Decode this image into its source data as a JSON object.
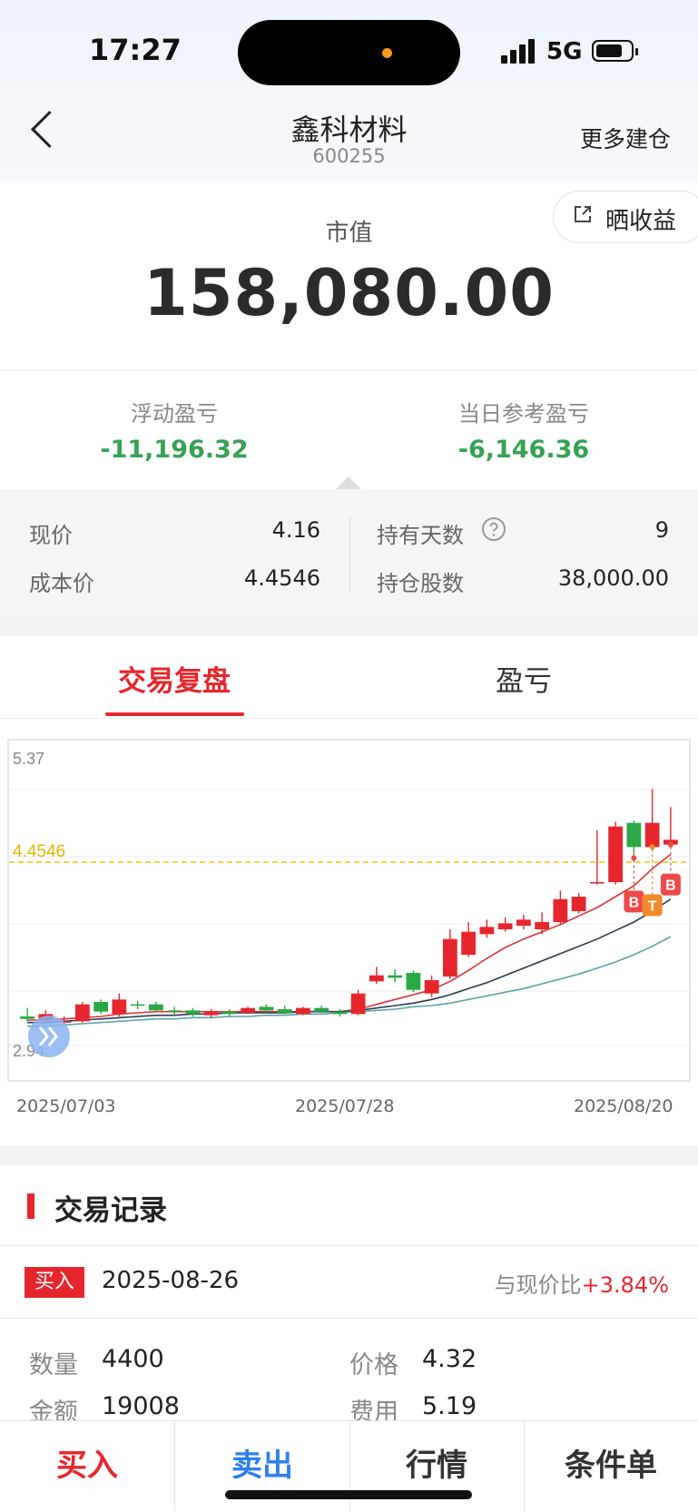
{
  "status_bar": {
    "time": "17:27",
    "network": "5G"
  },
  "header": {
    "title": "鑫科材料",
    "code": "600255",
    "more_label": "更多建仓"
  },
  "share": {
    "label": "晒收益"
  },
  "market_value": {
    "label": "市值",
    "value": "158,080.00"
  },
  "pnl": {
    "floating_label": "浮动盈亏",
    "floating_value": "-11,196.32",
    "daily_label": "当日参考盈亏",
    "daily_value": "-6,146.36"
  },
  "position": {
    "price_label": "现价",
    "price_value": "4.16",
    "cost_label": "成本价",
    "cost_value": "4.4546",
    "days_label": "持有天数",
    "days_value": "9",
    "shares_label": "持仓股数",
    "shares_value": "38,000.00"
  },
  "tabs": [
    {
      "label": "交易复盘"
    },
    {
      "label": "盈亏"
    }
  ],
  "chart": {
    "y_max_label": "5.37",
    "y_min_label": "2.94",
    "cost_line_label": "4.4546",
    "x_labels": [
      "2025/07/03",
      "2025/07/28",
      "2025/08/20"
    ],
    "markers": {
      "buy": "B",
      "t": "T"
    }
  },
  "chart_data": {
    "type": "candlestick",
    "ylim": [
      2.94,
      5.37
    ],
    "cost_line": 4.4546,
    "up_color": "#e5272d",
    "down_color": "#2aa845",
    "candles": [
      {
        "o": 3.18,
        "c": 3.16,
        "h": 3.25,
        "l": 3.14
      },
      {
        "o": 3.15,
        "c": 3.2,
        "h": 3.23,
        "l": 3.13
      },
      {
        "o": 3.13,
        "c": 3.14,
        "h": 3.18,
        "l": 3.11
      },
      {
        "o": 3.14,
        "c": 3.28,
        "h": 3.3,
        "l": 3.13
      },
      {
        "o": 3.3,
        "c": 3.22,
        "h": 3.32,
        "l": 3.2
      },
      {
        "o": 3.2,
        "c": 3.32,
        "h": 3.37,
        "l": 3.18
      },
      {
        "o": 3.28,
        "c": 3.27,
        "h": 3.31,
        "l": 3.24
      },
      {
        "o": 3.28,
        "c": 3.23,
        "h": 3.3,
        "l": 3.22
      },
      {
        "o": 3.23,
        "c": 3.22,
        "h": 3.26,
        "l": 3.19
      },
      {
        "o": 3.23,
        "c": 3.2,
        "h": 3.25,
        "l": 3.18
      },
      {
        "o": 3.19,
        "c": 3.22,
        "h": 3.24,
        "l": 3.17
      },
      {
        "o": 3.22,
        "c": 3.2,
        "h": 3.24,
        "l": 3.18
      },
      {
        "o": 3.21,
        "c": 3.25,
        "h": 3.26,
        "l": 3.2
      },
      {
        "o": 3.26,
        "c": 3.23,
        "h": 3.28,
        "l": 3.21
      },
      {
        "o": 3.24,
        "c": 3.21,
        "h": 3.27,
        "l": 3.2
      },
      {
        "o": 3.2,
        "c": 3.25,
        "h": 3.26,
        "l": 3.19
      },
      {
        "o": 3.25,
        "c": 3.22,
        "h": 3.27,
        "l": 3.21
      },
      {
        "o": 3.22,
        "c": 3.2,
        "h": 3.24,
        "l": 3.18
      },
      {
        "o": 3.2,
        "c": 3.37,
        "h": 3.4,
        "l": 3.19
      },
      {
        "o": 3.47,
        "c": 3.52,
        "h": 3.59,
        "l": 3.45
      },
      {
        "o": 3.52,
        "c": 3.5,
        "h": 3.57,
        "l": 3.46
      },
      {
        "o": 3.54,
        "c": 3.4,
        "h": 3.56,
        "l": 3.38
      },
      {
        "o": 3.37,
        "c": 3.48,
        "h": 3.52,
        "l": 3.34
      },
      {
        "o": 3.51,
        "c": 3.82,
        "h": 3.9,
        "l": 3.49
      },
      {
        "o": 3.69,
        "c": 3.88,
        "h": 3.96,
        "l": 3.67
      },
      {
        "o": 3.86,
        "c": 3.92,
        "h": 3.98,
        "l": 3.83
      },
      {
        "o": 3.9,
        "c": 3.95,
        "h": 4.0,
        "l": 3.88
      },
      {
        "o": 3.93,
        "c": 3.98,
        "h": 4.02,
        "l": 3.9
      },
      {
        "o": 3.9,
        "c": 3.96,
        "h": 4.04,
        "l": 3.86
      },
      {
        "o": 3.96,
        "c": 4.15,
        "h": 4.22,
        "l": 3.94
      },
      {
        "o": 4.05,
        "c": 4.17,
        "h": 4.2,
        "l": 4.03
      },
      {
        "o": 4.29,
        "c": 4.29,
        "h": 4.72,
        "l": 4.27
      },
      {
        "o": 4.29,
        "c": 4.75,
        "h": 4.79,
        "l": 4.27
      },
      {
        "o": 4.78,
        "c": 4.58,
        "h": 4.8,
        "l": 4.46
      },
      {
        "o": 4.58,
        "c": 4.78,
        "h": 5.06,
        "l": 4.55
      },
      {
        "o": 4.6,
        "c": 4.64,
        "h": 4.91,
        "l": 4.57
      }
    ],
    "ma_lines": [
      {
        "color": "#d93636",
        "values": [
          3.15,
          3.15,
          3.16,
          3.17,
          3.18,
          3.2,
          3.21,
          3.22,
          3.22,
          3.22,
          3.22,
          3.22,
          3.22,
          3.22,
          3.22,
          3.22,
          3.22,
          3.22,
          3.24,
          3.28,
          3.32,
          3.36,
          3.4,
          3.47,
          3.56,
          3.66,
          3.75,
          3.82,
          3.88,
          3.94,
          4.01,
          4.08,
          4.17,
          4.26,
          4.4,
          4.52
        ]
      },
      {
        "color": "#2b3a55",
        "values": [
          3.13,
          3.13,
          3.14,
          3.15,
          3.16,
          3.17,
          3.18,
          3.19,
          3.19,
          3.2,
          3.2,
          3.21,
          3.21,
          3.21,
          3.21,
          3.22,
          3.22,
          3.22,
          3.23,
          3.25,
          3.27,
          3.29,
          3.32,
          3.36,
          3.41,
          3.46,
          3.52,
          3.58,
          3.64,
          3.7,
          3.76,
          3.82,
          3.89,
          3.96,
          4.05,
          4.15
        ]
      },
      {
        "color": "#5aa3a8",
        "values": [
          3.1,
          3.1,
          3.11,
          3.12,
          3.13,
          3.14,
          3.15,
          3.16,
          3.16,
          3.17,
          3.17,
          3.18,
          3.18,
          3.19,
          3.19,
          3.2,
          3.2,
          3.21,
          3.22,
          3.23,
          3.24,
          3.26,
          3.27,
          3.29,
          3.32,
          3.35,
          3.38,
          3.41,
          3.45,
          3.49,
          3.53,
          3.58,
          3.63,
          3.69,
          3.76,
          3.84
        ]
      }
    ]
  },
  "trades_section": {
    "title": "交易记录"
  },
  "trade": {
    "type_label": "买入",
    "date": "2025-08-26",
    "compare_label": "与现价比",
    "compare_value": "+3.84%",
    "qty_label": "数量",
    "qty_value": "4400",
    "price_label": "价格",
    "price_value": "4.32",
    "amount_label": "金额",
    "amount_value": "19008",
    "fee_label": "费用",
    "fee_value": "5.19"
  },
  "bottom_bar": {
    "buy": "买入",
    "sell": "卖出",
    "quote": "行情",
    "conditional": "条件单"
  },
  "colors": {
    "red": "#e5272d",
    "green": "#38a155",
    "blue": "#2f80ed",
    "cost_line": "#f2c200"
  }
}
